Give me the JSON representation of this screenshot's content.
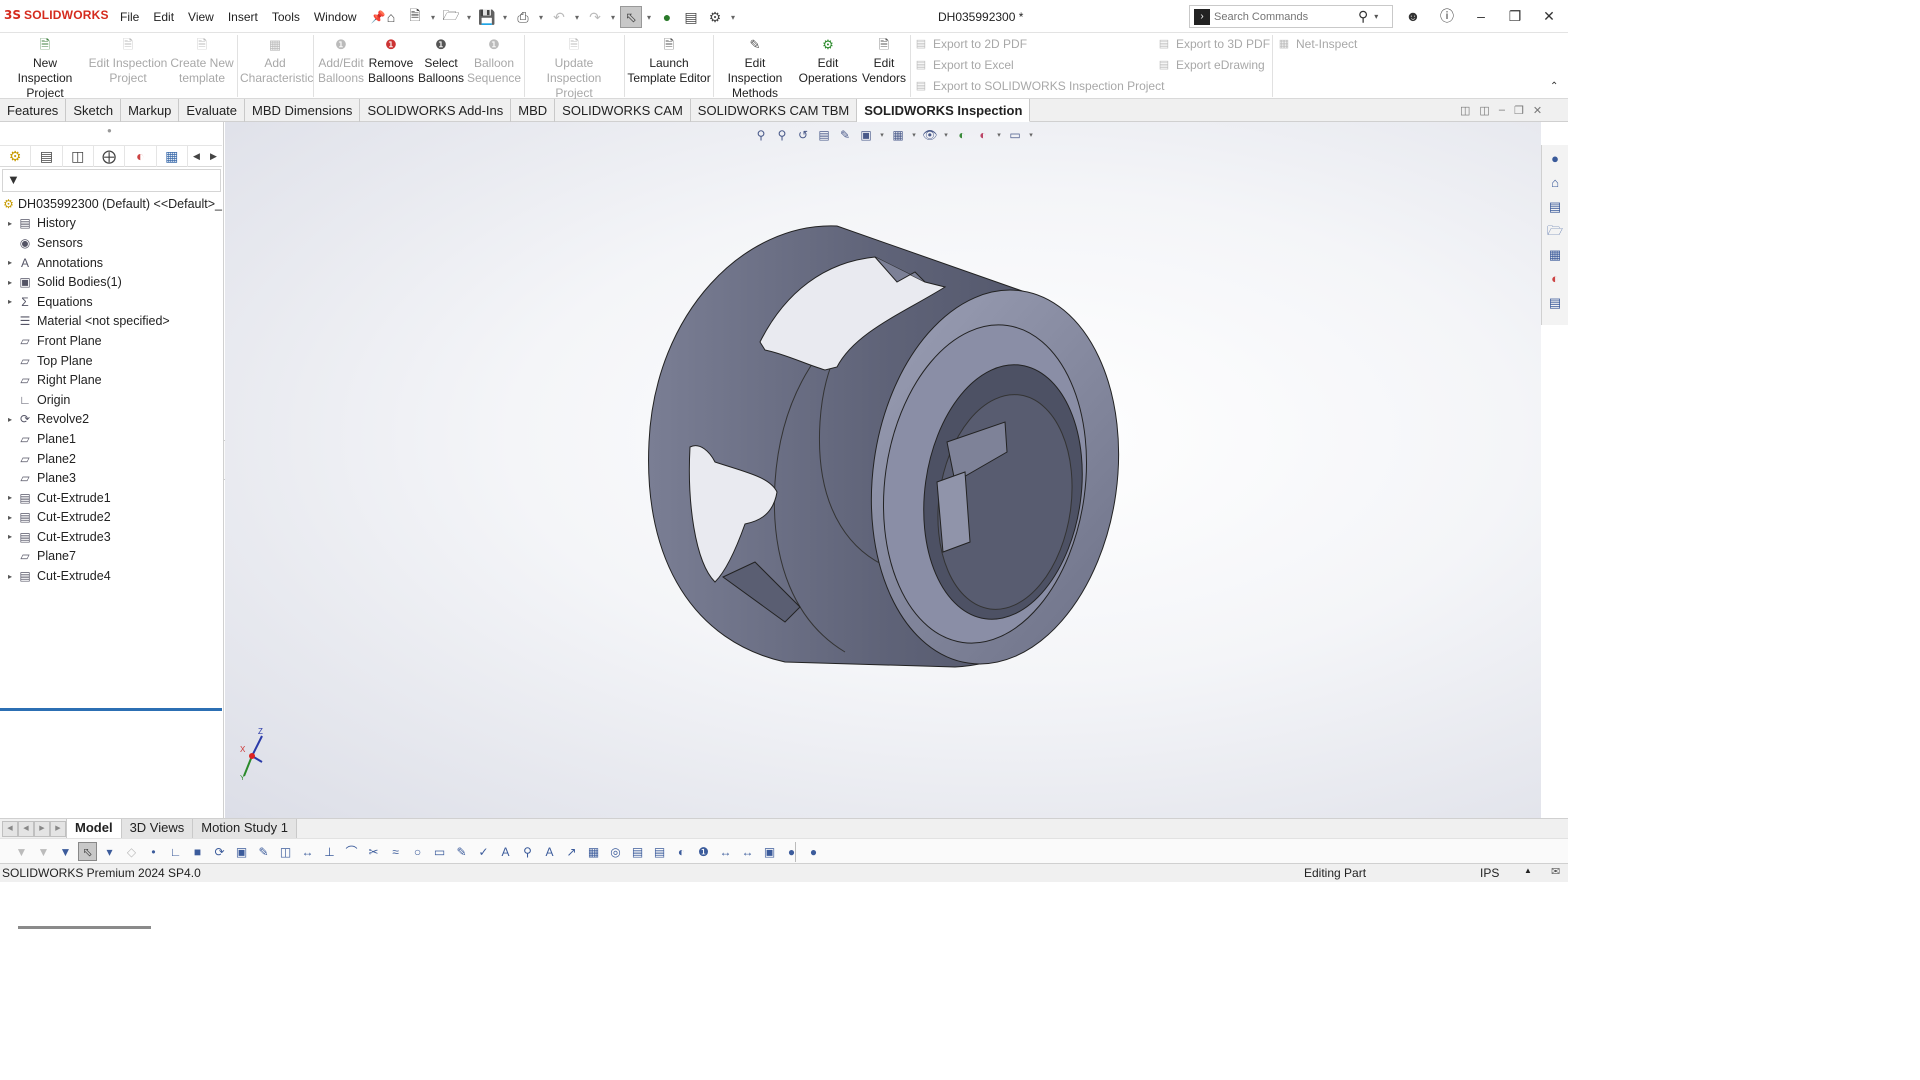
{
  "app": {
    "logo_ds": "3S",
    "brand": "SOLIDWORKS",
    "doc_title": "DH035992300 *"
  },
  "menu": [
    "File",
    "Edit",
    "View",
    "Insert",
    "Tools",
    "Window"
  ],
  "search": {
    "placeholder": "Search Commands"
  },
  "ribbon": {
    "new_inspection_project": "New Inspection Project",
    "edit_inspection_project": "Edit Inspection Project",
    "create_new_template": "Create New template",
    "add_characteristic": "Add Characteristic",
    "add_edit_balloons": "Add/Edit Balloons",
    "remove_balloons": "Remove Balloons",
    "select_balloons": "Select Balloons",
    "balloon_sequence": "Balloon Sequence",
    "update_inspection_project": "Update Inspection Project",
    "launch_template_editor": "Launch Template Editor",
    "edit_inspection_methods": "Edit Inspection Methods",
    "edit_operations": "Edit Operations",
    "edit_vendors": "Edit Vendors",
    "export_2d_pdf": "Export to 2D PDF",
    "export_excel": "Export to Excel",
    "export_sw_project": "Export to SOLIDWORKS Inspection Project",
    "export_3d_pdf": "Export to 3D PDF",
    "export_edrawing": "Export eDrawing",
    "net_inspect": "Net-Inspect"
  },
  "tabs": [
    "Features",
    "Sketch",
    "Markup",
    "Evaluate",
    "MBD Dimensions",
    "SOLIDWORKS Add-Ins",
    "MBD",
    "SOLIDWORKS CAM",
    "SOLIDWORKS CAM TBM",
    "SOLIDWORKS Inspection"
  ],
  "active_tab": "SOLIDWORKS Inspection",
  "tree": {
    "root": "DH035992300 (Default) <<Default>_",
    "items": [
      {
        "label": "History",
        "expandable": true
      },
      {
        "label": "Sensors",
        "expandable": false
      },
      {
        "label": "Annotations",
        "expandable": true
      },
      {
        "label": "Solid Bodies(1)",
        "expandable": true
      },
      {
        "label": "Equations",
        "expandable": true
      },
      {
        "label": "Material <not specified>",
        "expandable": false
      },
      {
        "label": "Front Plane",
        "expandable": false
      },
      {
        "label": "Top Plane",
        "expandable": false
      },
      {
        "label": "Right Plane",
        "expandable": false
      },
      {
        "label": "Origin",
        "expandable": false
      },
      {
        "label": "Revolve2",
        "expandable": true
      },
      {
        "label": "Plane1",
        "expandable": false
      },
      {
        "label": "Plane2",
        "expandable": false
      },
      {
        "label": "Plane3",
        "expandable": false
      },
      {
        "label": "Cut-Extrude1",
        "expandable": true
      },
      {
        "label": "Cut-Extrude2",
        "expandable": true
      },
      {
        "label": "Cut-Extrude3",
        "expandable": true
      },
      {
        "label": "Plane7",
        "expandable": false
      },
      {
        "label": "Cut-Extrude4",
        "expandable": true
      }
    ]
  },
  "triad": {
    "x": "X",
    "y": "Y",
    "z": "Z"
  },
  "bottom_tabs": [
    "Model",
    "3D Views",
    "Motion Study 1"
  ],
  "status": {
    "product": "SOLIDWORKS Premium 2024 SP4.0",
    "mode": "Editing Part",
    "units": "IPS"
  },
  "colors": {
    "accent": "#2c6fb3",
    "part": "#6b6f86",
    "brand": "#d52b1e"
  }
}
